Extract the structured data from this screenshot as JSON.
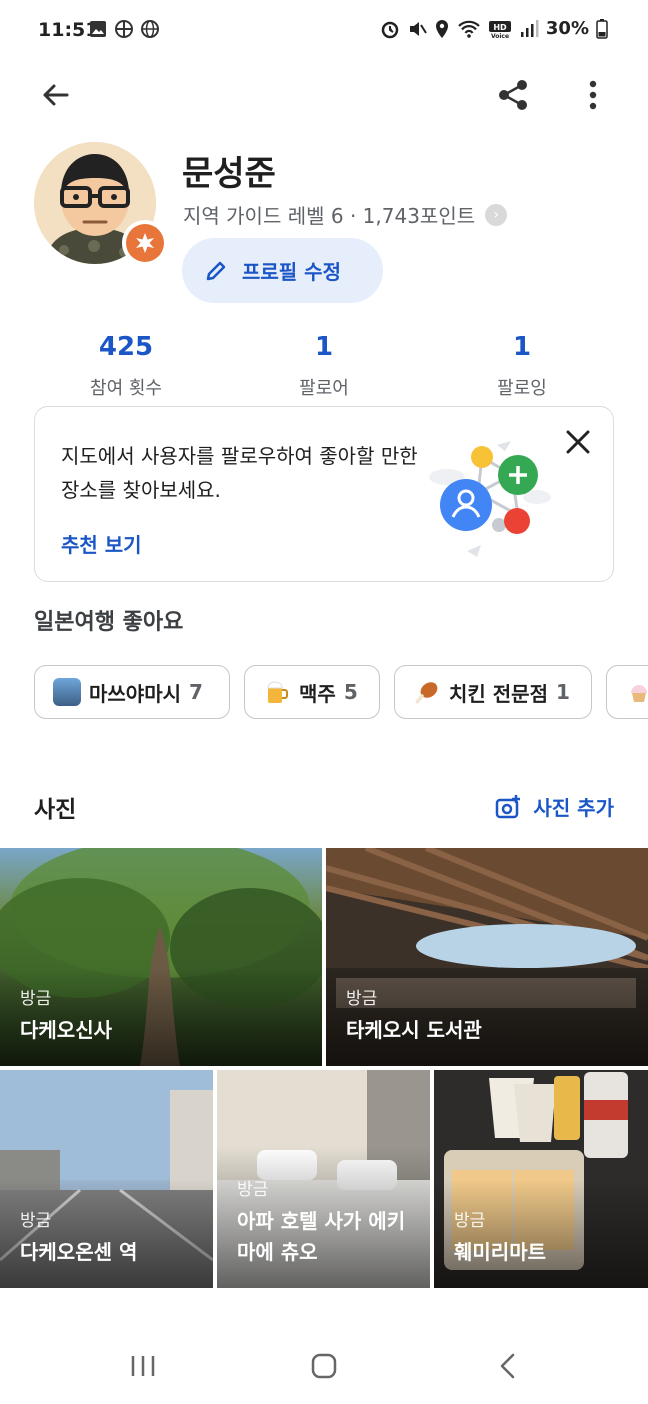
{
  "status_bar": {
    "time": "11:51",
    "battery": "30%"
  },
  "profile": {
    "name": "문성준",
    "level_text": "지역 가이드 레벨 6 · 1,743포인트",
    "edit_button": "프로필 수정"
  },
  "stats": [
    {
      "value": "425",
      "label": "참여 횟수"
    },
    {
      "value": "1",
      "label": "팔로어"
    },
    {
      "value": "1",
      "label": "팔로잉"
    }
  ],
  "suggest_card": {
    "text": "지도에서 사용자를 팔로우하여 좋아할 만한 장소를 찾아보세요.",
    "link": "추천 보기"
  },
  "likes": {
    "title": "일본여행 좋아요",
    "chips": [
      {
        "label": "마쓰야마시",
        "count": "7",
        "icon": "city-photo"
      },
      {
        "label": "맥주",
        "count": "5",
        "icon": "beer-emoji"
      },
      {
        "label": "치킨 전문점",
        "count": "1",
        "icon": "chicken-emoji"
      }
    ]
  },
  "photos": {
    "title": "사진",
    "add_label": "사진 추가",
    "items": [
      {
        "sub": "방금",
        "title": "다케오신사"
      },
      {
        "sub": "방금",
        "title": "타케오시 도서관"
      },
      {
        "sub": "방금",
        "title": "다케오온센 역"
      },
      {
        "sub": "방금",
        "title": "아파 호텔 사가 에키마에 츄오"
      },
      {
        "sub": "방금",
        "title": "훼미리마트"
      }
    ]
  },
  "colors": {
    "accent": "#1a56c6",
    "chip_border": "#c4c7c5"
  }
}
